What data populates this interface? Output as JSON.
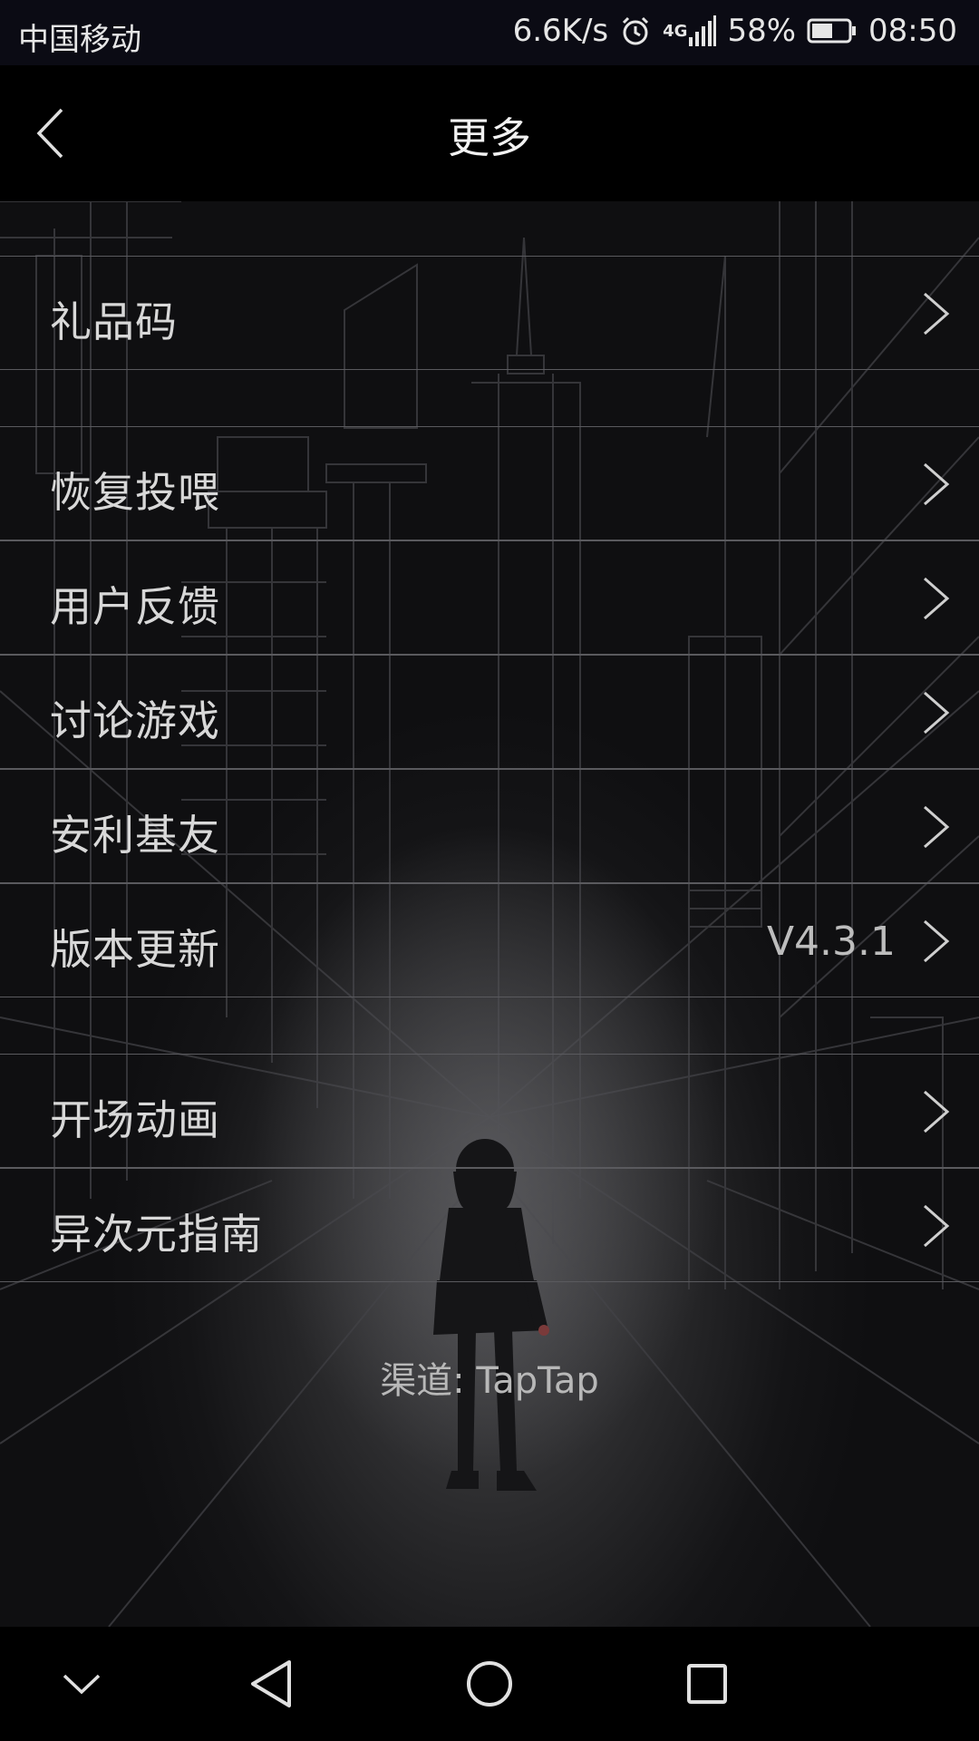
{
  "status_bar": {
    "carrier": "中国移动",
    "net_speed": "6.6K/s",
    "network_type": "4G",
    "battery_percent": "58%",
    "battery_level": 0.58,
    "time": "08:50",
    "icons": [
      "alarm-icon",
      "signal-icon",
      "battery-icon"
    ]
  },
  "header": {
    "title": "更多",
    "back_icon": "chevron-left-icon"
  },
  "menu": {
    "items": [
      {
        "label": "礼品码",
        "value": ""
      },
      {
        "label": "恢复投喂",
        "value": ""
      },
      {
        "label": "用户反馈",
        "value": ""
      },
      {
        "label": "讨论游戏",
        "value": ""
      },
      {
        "label": "安利基友",
        "value": ""
      },
      {
        "label": "版本更新",
        "value": "V4.3.1"
      },
      {
        "label": "开场动画",
        "value": ""
      },
      {
        "label": "异次元指南",
        "value": ""
      }
    ]
  },
  "footer": {
    "channel": "渠道: TapTap"
  },
  "nav_bar": {
    "buttons": [
      "chevron-down-icon",
      "back-triangle-icon",
      "home-circle-icon",
      "recents-square-icon"
    ]
  },
  "colors": {
    "status_bg": "#0b0b14",
    "header_bg": "#000000",
    "row_divider": "#5a5a5e",
    "text_primary": "#d8d8d8"
  }
}
